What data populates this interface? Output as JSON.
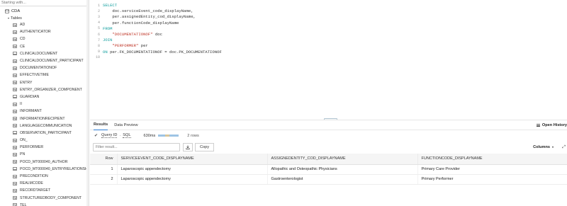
{
  "sidebar": {
    "filter_placeholder": "Starting with...",
    "database": "CDA",
    "tables_label": "Tables",
    "tables": [
      "AD",
      "AUTHENTICATOR",
      "CD",
      "CE",
      "CLINICALDOCUMENT",
      "CLINICALDOCUMENT_PARTICIPANT",
      "DOCUMENTATIONOF",
      "EFFECTIVETIME",
      "ENTRY",
      "ENTRY_ORGANIZER_COMPONENT",
      "GUARDIAN",
      "II",
      "INFORMANT",
      "INFORMATIONRECIPIENT",
      "LANGUAGECOMMUNICATION",
      "OBSERVATION_PARTICIPANT",
      "ON_",
      "PERFORMER",
      "PN",
      "POCD_MT000040_AUTHOR",
      "POCD_MT000040_ENTRYRELATIONSHI",
      "PRECONDITION",
      "REALMCODE",
      "RECORDTARGET",
      "STRUCTUREDBODY_COMPONENT",
      "TEL"
    ]
  },
  "editor": {
    "lines": [
      {
        "n": "1",
        "parts": [
          {
            "t": "kw",
            "s": "SELECT"
          }
        ]
      },
      {
        "n": "2",
        "parts": [
          {
            "t": "id",
            "s": "    doc.serviceEvent_code_displayName,"
          }
        ]
      },
      {
        "n": "3",
        "parts": [
          {
            "t": "id",
            "s": "    per.assignedEntity_cod_displayName,"
          }
        ]
      },
      {
        "n": "4",
        "parts": [
          {
            "t": "id",
            "s": "    per.functionCode_displayName"
          }
        ]
      },
      {
        "n": "5",
        "parts": [
          {
            "t": "kw",
            "s": "FROM"
          }
        ]
      },
      {
        "n": "6",
        "parts": [
          {
            "t": "str",
            "s": "    \"DOCUMENTATIONOF\""
          },
          {
            "t": "id",
            "s": " doc"
          }
        ]
      },
      {
        "n": "7",
        "parts": [
          {
            "t": "kw",
            "s": "JOIN"
          }
        ]
      },
      {
        "n": "8",
        "parts": [
          {
            "t": "str",
            "s": "    \"PERFORMER\""
          },
          {
            "t": "id",
            "s": " per"
          }
        ]
      },
      {
        "n": "9",
        "parts": [
          {
            "t": "kw",
            "s": "ON"
          },
          {
            "t": "id",
            "s": " per.FK_DOCUMENTATIONOF = doc.PK_DOCUMENTATIONOF"
          }
        ]
      },
      {
        "n": "10",
        "parts": []
      }
    ]
  },
  "results": {
    "tabs": [
      "Results",
      "Data Preview"
    ],
    "open_history": "Open History",
    "query_id": "Query ID",
    "sql": "SQL",
    "duration": "630ms",
    "rows": "2 rows",
    "filter_placeholder": "Filter result...",
    "copy_label": "Copy",
    "columns_label": "Columns",
    "headers": [
      "Row",
      "SERVICEEVENT_CODE_DISPLAYNAME",
      "ASSIGNEDENTITY_COD_DISPLAYNAME",
      "FUNCTIONCODE_DISPLAYNAME"
    ],
    "rows_data": [
      [
        "1",
        "Laparoscopic appendectomy",
        "Allopathic and Osteopathic Physicians",
        "Primary Care Provider"
      ],
      [
        "2",
        "Laparoscopic appendectomy",
        "Gastroenterologist",
        "Primary Performer"
      ]
    ]
  },
  "colors": {
    "accent": "#2b7bd3",
    "keyword": "#0d9d9d",
    "string": "#c0392b"
  }
}
